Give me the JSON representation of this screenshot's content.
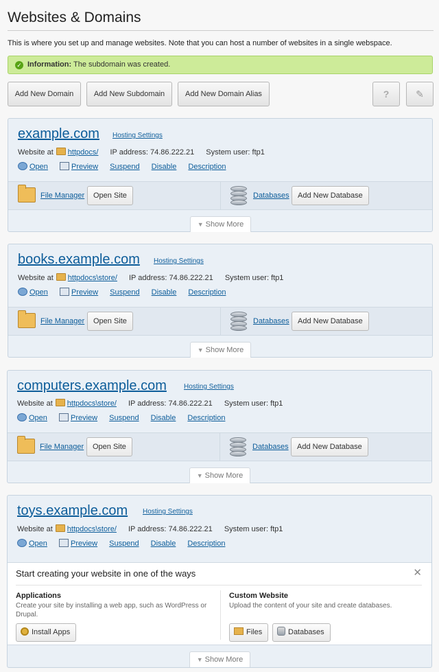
{
  "page": {
    "title": "Websites & Domains",
    "intro": "This is where you set up and manage websites. Note that you can host a number of websites in a single webspace.",
    "message": {
      "label": "Information:",
      "text": "The subdomain was created."
    }
  },
  "toolbar": {
    "add_domain": "Add New Domain",
    "add_subdomain": "Add New Subdomain",
    "add_alias": "Add New Domain Alias",
    "help": "?",
    "settings_icon": "wrench-icon"
  },
  "labels": {
    "hosting_settings": "Hosting Settings",
    "website_at": "Website at",
    "ip_label": "IP address:",
    "user_label": "System user:",
    "open": "Open",
    "preview": "Preview",
    "suspend": "Suspend",
    "disable": "Disable",
    "description": "Description",
    "file_manager": "File Manager",
    "open_site": "Open Site",
    "databases": "Databases",
    "add_database": "Add New Database",
    "show_more": "Show More"
  },
  "domains": [
    {
      "name": "example.com",
      "path": "httpdocs/",
      "ip": "74.86.222.21",
      "user": "ftp1"
    },
    {
      "name": "books.example.com",
      "path": "httpdocs\\store/",
      "ip": "74.86.222.21",
      "user": "ftp1"
    },
    {
      "name": "computers.example.com",
      "path": "httpdocs\\store/",
      "ip": "74.86.222.21",
      "user": "ftp1"
    },
    {
      "name": "toys.example.com",
      "path": "httpdocs\\store/",
      "ip": "74.86.222.21",
      "user": "ftp1"
    }
  ],
  "start_panel": {
    "title": "Start creating your website in one of the ways",
    "apps_title": "Applications",
    "apps_desc": "Create your site by installing a web app, such as WordPress or Drupal.",
    "install_apps": "Install Apps",
    "custom_title": "Custom Website",
    "custom_desc": "Upload the content of your site and create databases.",
    "files": "Files",
    "databases": "Databases"
  }
}
